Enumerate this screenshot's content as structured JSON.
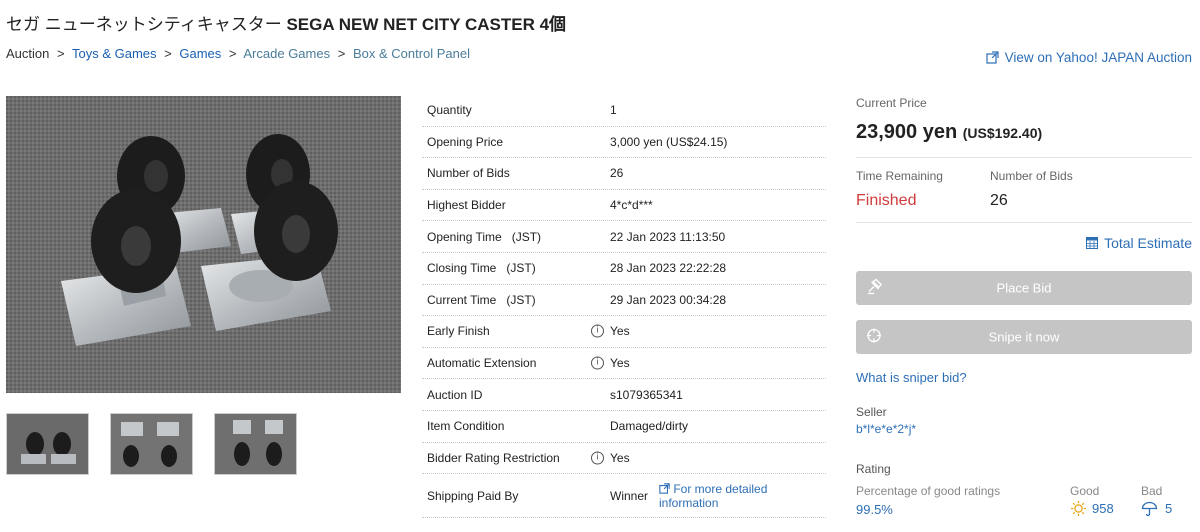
{
  "title": {
    "jp": "セガ ニューネットシティキャスター",
    "en": "SEGA NEW NET CITY CASTER 4個"
  },
  "breadcrumb": {
    "items": [
      "Auction",
      "Toys & Games",
      "Games",
      "Arcade Games",
      "Box & Control Panel"
    ],
    "separator": ">"
  },
  "yahoo_link": "View on Yahoo! JAPAN Auction",
  "gallery": {
    "thumbnail_count": 3
  },
  "details": [
    {
      "label": "Quantity",
      "value": "1"
    },
    {
      "label": "Opening Price",
      "value": "3,000 yen (US$24.15)"
    },
    {
      "label": "Number of Bids",
      "value": "26"
    },
    {
      "label": "Highest Bidder",
      "value": "4*c*d***"
    },
    {
      "label": "Opening Time   (JST)",
      "value": "22 Jan 2023 11:13:50"
    },
    {
      "label": "Closing Time   (JST)",
      "value": "28 Jan 2023 22:22:28"
    },
    {
      "label": "Current Time   (JST)",
      "value": "29 Jan 2023 00:34:28"
    },
    {
      "label": "Early Finish",
      "value": "Yes"
    },
    {
      "label": "Automatic Extension",
      "value": "Yes"
    },
    {
      "label": "Auction ID",
      "value": "s1079365341"
    },
    {
      "label": "Item Condition",
      "value": "Damaged/dirty"
    },
    {
      "label": "Bidder Rating Restriction",
      "value": "Yes"
    },
    {
      "label": "Shipping Paid By",
      "value": "Winner"
    }
  ],
  "more_info": "For more detailed information",
  "panel": {
    "current_price_label": "Current Price",
    "price_yen": "23,900 yen",
    "price_usd": "(US$192.40)",
    "time_remaining_label": "Time Remaining",
    "time_remaining_value": "Finished",
    "bids_label": "Number of Bids",
    "bids_value": "26",
    "total_estimate": "Total Estimate",
    "place_bid": "Place Bid",
    "snipe": "Snipe it now",
    "sniper_question": "What is sniper bid?",
    "seller_label": "Seller",
    "seller_value": "b*l*e*e*2*j*",
    "rating_label": "Rating",
    "pct_label": "Percentage of good ratings",
    "pct_value": "99.5%",
    "good_label": "Good",
    "good_value": "958",
    "bad_label": "Bad",
    "bad_value": "5"
  },
  "colors": {
    "link": "#2d6fb5",
    "finished": "#d03a3a",
    "button_disabled": "#c5c5c5",
    "good_icon": "#e8a317"
  }
}
